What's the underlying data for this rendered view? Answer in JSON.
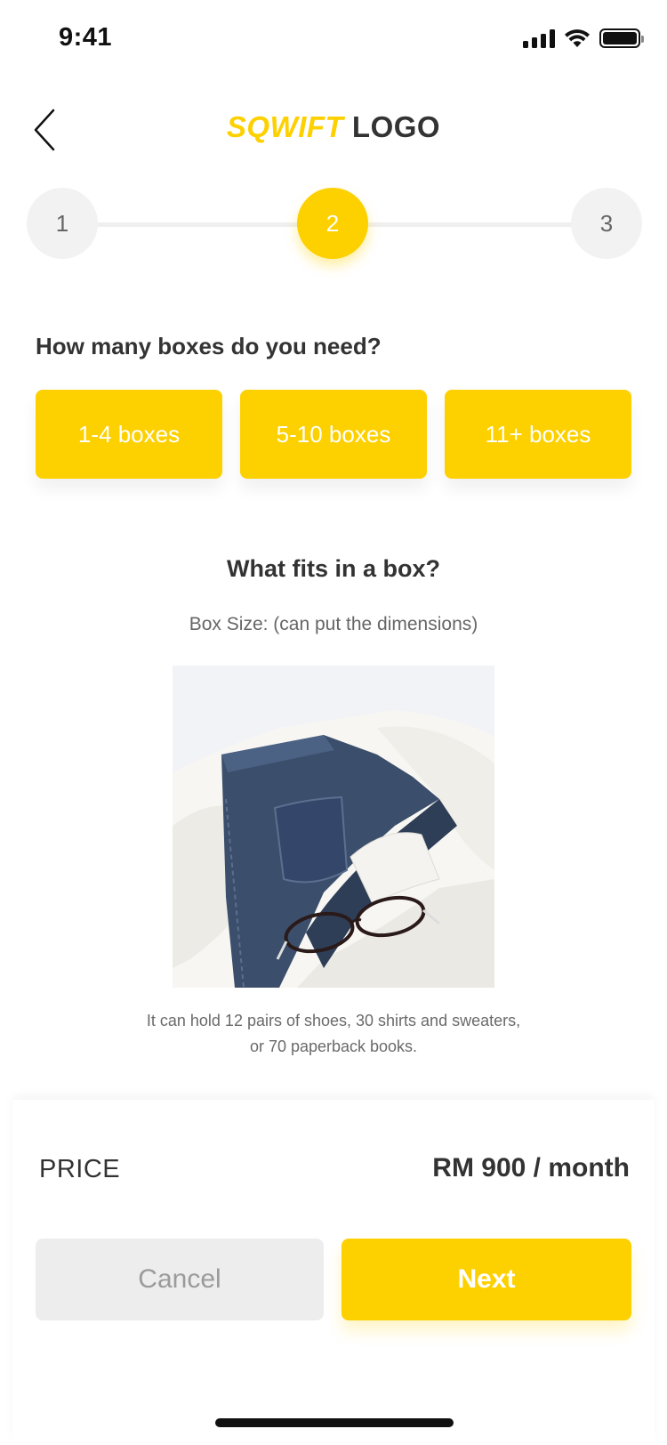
{
  "status_bar": {
    "time": "9:41"
  },
  "header": {
    "logo_brand": "SQWIFT",
    "logo_word": "LOGO"
  },
  "stepper": {
    "steps": [
      "1",
      "2",
      "3"
    ],
    "active_step": "2"
  },
  "question": {
    "title": "How many boxes do you need?",
    "options": [
      "1-4 boxes",
      "5-10 boxes",
      "11+ boxes"
    ]
  },
  "box_info": {
    "title": "What fits in a box?",
    "size_text": "Box Size: (can put the dimensions)",
    "caption_line1": "It can hold 12 pairs of shoes, 30 shirts and sweaters,",
    "caption_line2": "or 70 paperback books."
  },
  "footer": {
    "price_label": "PRICE",
    "price_value": "RM 900 / month",
    "cancel_label": "Cancel",
    "next_label": "Next"
  },
  "colors": {
    "accent": "#FDD000",
    "text": "#333333",
    "muted": "#666666",
    "cancel_bg": "#EDEDED"
  }
}
